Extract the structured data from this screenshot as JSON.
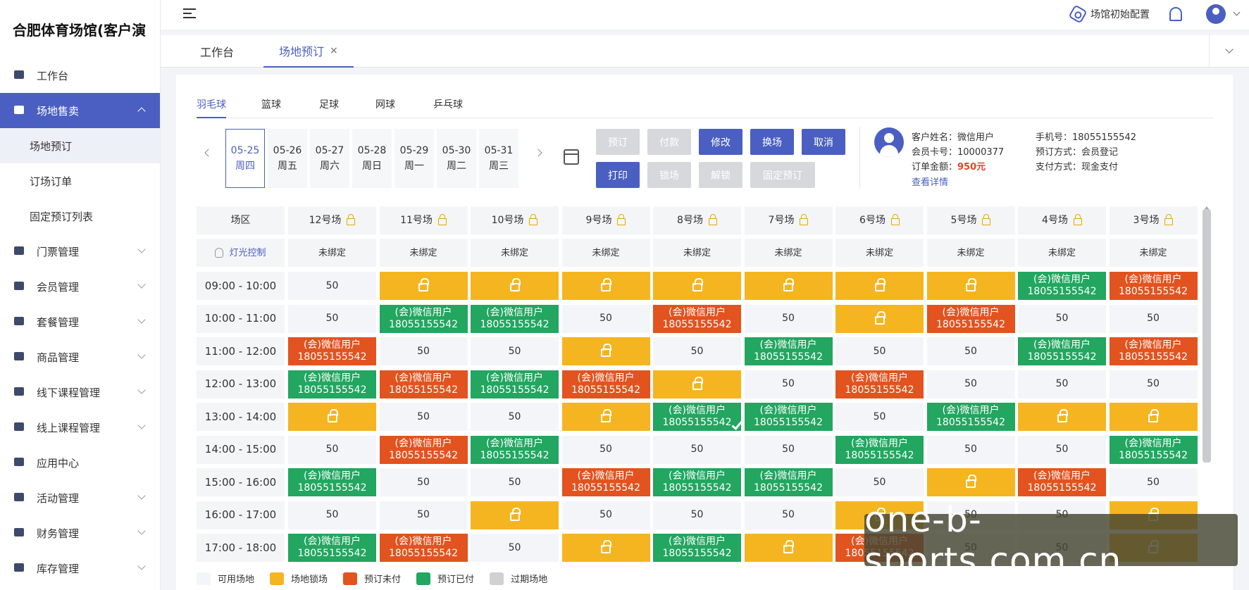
{
  "app": {
    "title": "合肥体育场馆(客户演"
  },
  "sidebar": {
    "items": [
      {
        "label": "工作台",
        "expandable": false
      },
      {
        "label": "场地售卖",
        "expandable": true,
        "active": true,
        "children": [
          {
            "label": "场地预订",
            "active": true
          },
          {
            "label": "订场订单"
          },
          {
            "label": "固定预订列表"
          }
        ]
      },
      {
        "label": "门票管理",
        "expandable": true
      },
      {
        "label": "会员管理",
        "expandable": true
      },
      {
        "label": "套餐管理",
        "expandable": true
      },
      {
        "label": "商品管理",
        "expandable": true
      },
      {
        "label": "线下课程管理",
        "expandable": true
      },
      {
        "label": "线上课程管理",
        "expandable": true
      },
      {
        "label": "应用中心",
        "expandable": false
      },
      {
        "label": "活动管理",
        "expandable": true
      },
      {
        "label": "财务管理",
        "expandable": true
      },
      {
        "label": "库存管理",
        "expandable": true
      }
    ]
  },
  "topbar": {
    "config_label": "场馆初始配置"
  },
  "tabs": [
    {
      "label": "工作台"
    },
    {
      "label": "场地预订",
      "close": "×",
      "active": true
    }
  ],
  "sport_tabs": [
    "羽毛球",
    "篮球",
    "足球",
    "网球",
    "乒乓球"
  ],
  "dates": [
    {
      "date": "05-25",
      "weekday": "周四",
      "active": true
    },
    {
      "date": "05-26",
      "weekday": "周五"
    },
    {
      "date": "05-27",
      "weekday": "周六"
    },
    {
      "date": "05-28",
      "weekday": "周日"
    },
    {
      "date": "05-29",
      "weekday": "周一"
    },
    {
      "date": "05-30",
      "weekday": "周二"
    },
    {
      "date": "05-31",
      "weekday": "周三"
    }
  ],
  "actions": {
    "row1": [
      {
        "label": "预订",
        "style": "gray"
      },
      {
        "label": "付款",
        "style": "gray"
      },
      {
        "label": "修改",
        "style": "blue"
      },
      {
        "label": "换场",
        "style": "blue"
      },
      {
        "label": "取消",
        "style": "blue"
      }
    ],
    "row2": [
      {
        "label": "打印",
        "style": "blue"
      },
      {
        "label": "锁场",
        "style": "gray"
      },
      {
        "label": "解锁",
        "style": "gray"
      },
      {
        "label": "固定预订",
        "style": "gray"
      }
    ]
  },
  "customer": {
    "name_label": "客户姓名：",
    "name": "微信用户",
    "card_label": "会员卡号：",
    "card": "10000377",
    "amount_label": "订单金额：",
    "amount": "950元",
    "phone_label": "手机号：",
    "phone": "18055155542",
    "booking_label": "预订方式：",
    "booking": "会员登记",
    "payment_label": "支付方式：",
    "payment": "现金支付",
    "detail_link": "查看详情"
  },
  "grid": {
    "corner": "场区",
    "light_label": "灯光控制",
    "courts": [
      "12号场",
      "11号场",
      "10号场",
      "9号场",
      "8号场",
      "7号场",
      "6号场",
      "5号场",
      "4号场",
      "3号场"
    ],
    "binding": "未绑定",
    "price": "50",
    "booking_line1": "(会)微信用户",
    "booking_line2": "18055155542",
    "rows": [
      {
        "time": "09:00 - 10:00",
        "slots": [
          "A",
          "L",
          "L",
          "L",
          "L",
          "L",
          "L",
          "L",
          "P",
          "U"
        ]
      },
      {
        "time": "10:00 - 11:00",
        "slots": [
          "A",
          "P",
          "P",
          "A",
          "U",
          "A",
          "L",
          "U",
          "A",
          "A"
        ]
      },
      {
        "time": "11:00 - 12:00",
        "slots": [
          "U",
          "A",
          "A",
          "L",
          "A",
          "P",
          "A",
          "A",
          "P",
          "U"
        ]
      },
      {
        "time": "12:00 - 13:00",
        "slots": [
          "P",
          "U",
          "P",
          "U",
          "L",
          "A",
          "U",
          "A",
          "A",
          "A"
        ]
      },
      {
        "time": "13:00 - 14:00",
        "slots": [
          "L",
          "A",
          "A",
          "L",
          "PS",
          "P",
          "A",
          "P",
          "L",
          "L"
        ]
      },
      {
        "time": "14:00 - 15:00",
        "slots": [
          "A",
          "U",
          "P",
          "A",
          "A",
          "A",
          "P",
          "A",
          "A",
          "P"
        ]
      },
      {
        "time": "15:00 - 16:00",
        "slots": [
          "P",
          "A",
          "A",
          "U",
          "P",
          "P",
          "A",
          "L",
          "U",
          "A"
        ]
      },
      {
        "time": "16:00 - 17:00",
        "slots": [
          "A",
          "A",
          "L",
          "A",
          "A",
          "A",
          "L",
          "A",
          "A",
          "L"
        ]
      },
      {
        "time": "17:00 - 18:00",
        "slots": [
          "P",
          "U",
          "A",
          "L",
          "P",
          "L",
          "U",
          "A",
          "A",
          "L"
        ]
      }
    ]
  },
  "legend": [
    {
      "label": "可用场地",
      "color": "#f4f5f9"
    },
    {
      "label": "场地锁场",
      "color": "#f5b521"
    },
    {
      "label": "预订未付",
      "color": "#e2531f"
    },
    {
      "label": "预订已付",
      "color": "#22a660"
    },
    {
      "label": "过期场地",
      "color": "#cfd1d4"
    }
  ],
  "watermark": "one-b-sports.com.cn"
}
